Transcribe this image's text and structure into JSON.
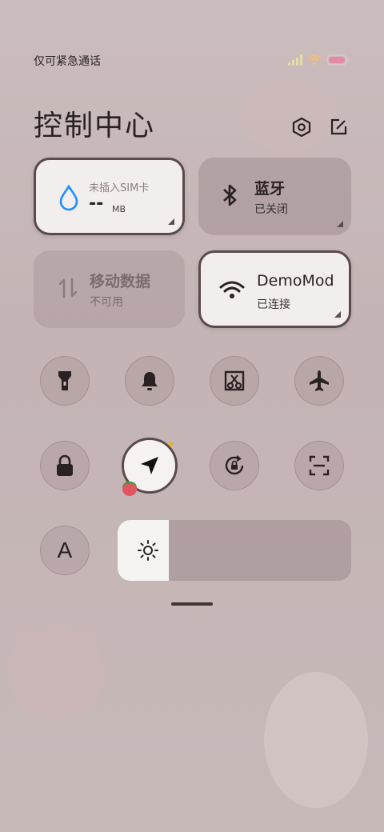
{
  "status": {
    "carrier": "仅可紧急通话"
  },
  "header": {
    "title": "控制中心"
  },
  "tiles": {
    "sim": {
      "label": "未插入SIM卡",
      "value": "--",
      "unit": "MB"
    },
    "bluetooth": {
      "label": "蓝牙",
      "sub": "已关闭"
    },
    "mobile_data": {
      "label": "移动数据",
      "sub": "不可用"
    },
    "wifi": {
      "label": "DemoMod",
      "sub": "已连接"
    }
  },
  "toggles_row1": [
    {
      "icon": "flashlight-icon"
    },
    {
      "icon": "bell-icon"
    },
    {
      "icon": "screenshot-icon"
    },
    {
      "icon": "airplane-icon"
    }
  ],
  "toggles_row2": [
    {
      "icon": "lock-icon"
    },
    {
      "icon": "location-icon",
      "active": true
    },
    {
      "icon": "rotation-lock-icon"
    },
    {
      "icon": "scan-icon"
    }
  ],
  "font_button": {
    "label": "A"
  },
  "brightness": {
    "level": 0.22
  },
  "colors": {
    "accent": "#1e90ff",
    "tile_border": "#5a4a4e"
  }
}
